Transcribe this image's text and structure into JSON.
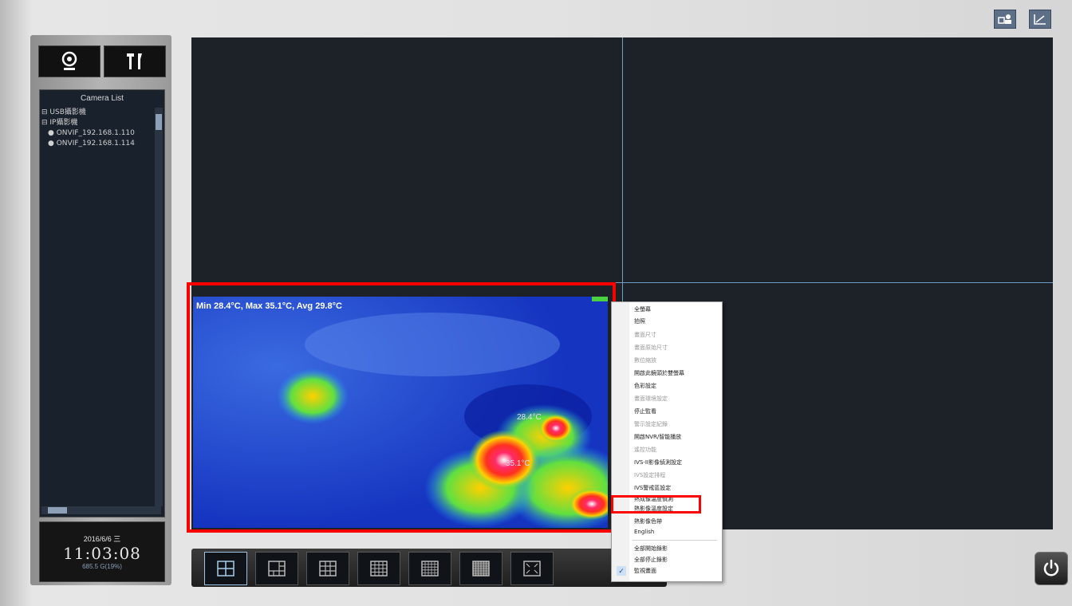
{
  "camera_list": {
    "title": "Camera List",
    "groups": [
      {
        "label": "USB攝影機"
      },
      {
        "label": "IP攝影機",
        "items": [
          "ONVIF_192.168.1.110",
          "ONVIF_192.168.1.114"
        ]
      }
    ]
  },
  "clock": {
    "date": "2016/6/6 三",
    "time": "11:03:08",
    "sub": "685.5 G(19%)"
  },
  "thermal": {
    "stats": "Min 28.4°C, Max 35.1°C, Avg 29.8°C",
    "label_min": "28.4°C",
    "label_max": "35.1°C"
  },
  "context_menu": {
    "items": [
      {
        "label": "全螢幕",
        "disabled": false
      },
      {
        "label": "拍照",
        "disabled": false
      },
      {
        "label": "畫面尺寸",
        "disabled": true
      },
      {
        "label": "畫面原始尺寸",
        "disabled": true
      },
      {
        "label": "數位縮放",
        "disabled": true
      },
      {
        "label": "開啟此鏡頭於雙螢幕",
        "disabled": false
      },
      {
        "label": "色彩設定",
        "disabled": false
      },
      {
        "label": "畫面環境設定",
        "disabled": true
      },
      {
        "label": "停止監看",
        "disabled": false
      },
      {
        "label": "警示設定紀錄",
        "disabled": true
      },
      {
        "label": "開啟NVR/智能播放",
        "disabled": false
      },
      {
        "label": "遙控功能",
        "disabled": true
      },
      {
        "label": "IVS-II影像偵測設定",
        "disabled": false
      },
      {
        "label": "IVS設定排程",
        "disabled": true
      },
      {
        "label": "IVS警戒區設定",
        "disabled": false
      },
      {
        "label": "熱成像溫度偵測",
        "disabled": false
      },
      {
        "label": "熱影像溫度設定",
        "disabled": false
      },
      {
        "label": "熱影像色帶",
        "disabled": false
      },
      {
        "label": "English",
        "disabled": false
      },
      {
        "label": "全部開始錄影",
        "disabled": false
      },
      {
        "label": "全部停止錄影",
        "disabled": false
      },
      {
        "label": "監視畫面",
        "disabled": false
      }
    ]
  },
  "colors": {
    "accent": "#6f9ec4",
    "highlight": "#ff0000",
    "video_bg": "#1c2228"
  },
  "layout_buttons": [
    "layout-2x2",
    "layout-1plus5",
    "layout-3x3",
    "layout-4x4",
    "layout-5x5",
    "layout-6x6",
    "fullscreen-view"
  ]
}
